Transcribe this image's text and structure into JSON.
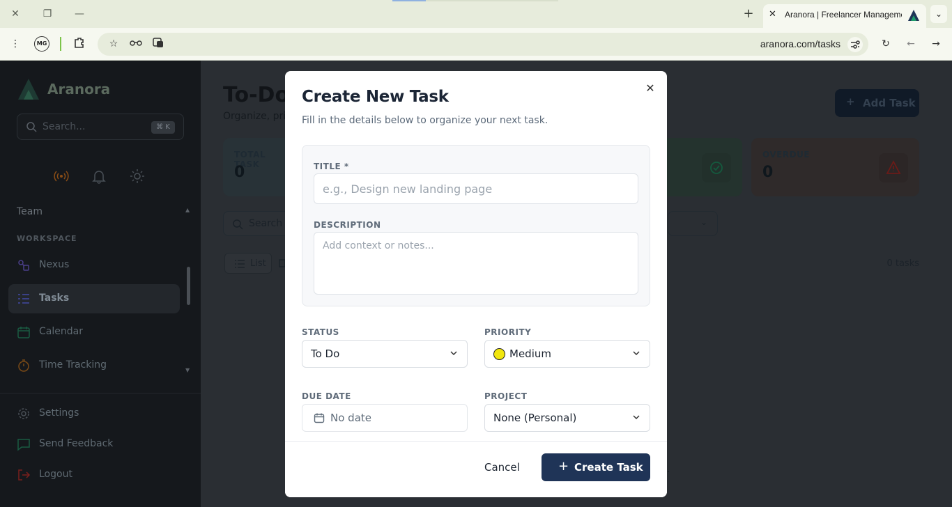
{
  "browser": {
    "tab_title": "Aranora | Freelancer Management",
    "url": "aranora.com/tasks",
    "profile_initials": "MG"
  },
  "sidebar": {
    "brand": "Aranora",
    "search_placeholder": "Search...",
    "search_shortcut": "⌘ K",
    "partial_item": "Team",
    "section_label": "WORKSPACE",
    "items": [
      {
        "label": "Nexus",
        "icon": "nexus-icon",
        "color": "#7b5cd6"
      },
      {
        "label": "Tasks",
        "icon": "tasks-icon",
        "color": "#5b63d3"
      },
      {
        "label": "Calendar",
        "icon": "calendar-icon",
        "color": "#1f9d6b"
      },
      {
        "label": "Time Tracking",
        "icon": "stopwatch-icon",
        "color": "#d67b1c"
      }
    ],
    "bottom_items": [
      {
        "label": "Settings",
        "icon": "gear-icon"
      },
      {
        "label": "Send Feedback",
        "icon": "chat-icon",
        "color": "#1f9d6b"
      },
      {
        "label": "Logout",
        "icon": "logout-icon",
        "color": "#c7322d"
      }
    ]
  },
  "main": {
    "title": "To-Do",
    "subtitle": "Organize, pri",
    "add_task_label": "Add Task",
    "stats": [
      {
        "label": "TOTAL TASK",
        "value": "0"
      },
      {
        "label": "OVERDUE",
        "value": "0"
      }
    ],
    "search_placeholder": "Search",
    "view_label": "List",
    "task_count": "0 tasks"
  },
  "modal": {
    "title": "Create New Task",
    "subtitle": "Fill in the details below to organize your next task.",
    "title_label": "TITLE *",
    "title_placeholder": "e.g., Design new landing page",
    "description_label": "DESCRIPTION",
    "description_placeholder": "Add context or notes...",
    "status_label": "STATUS",
    "status_value": "To Do",
    "priority_label": "PRIORITY",
    "priority_value": "Medium",
    "priority_color": "#f1e60e",
    "due_date_label": "DUE DATE",
    "due_date_value": "No date",
    "project_label": "PROJECT",
    "project_value": "None (Personal)",
    "cancel_label": "Cancel",
    "create_label": "Create Task"
  },
  "colors": {
    "primary_button": "#1f3457",
    "accent_green": "#1f9d6b",
    "overdue_red": "#c7322d"
  }
}
